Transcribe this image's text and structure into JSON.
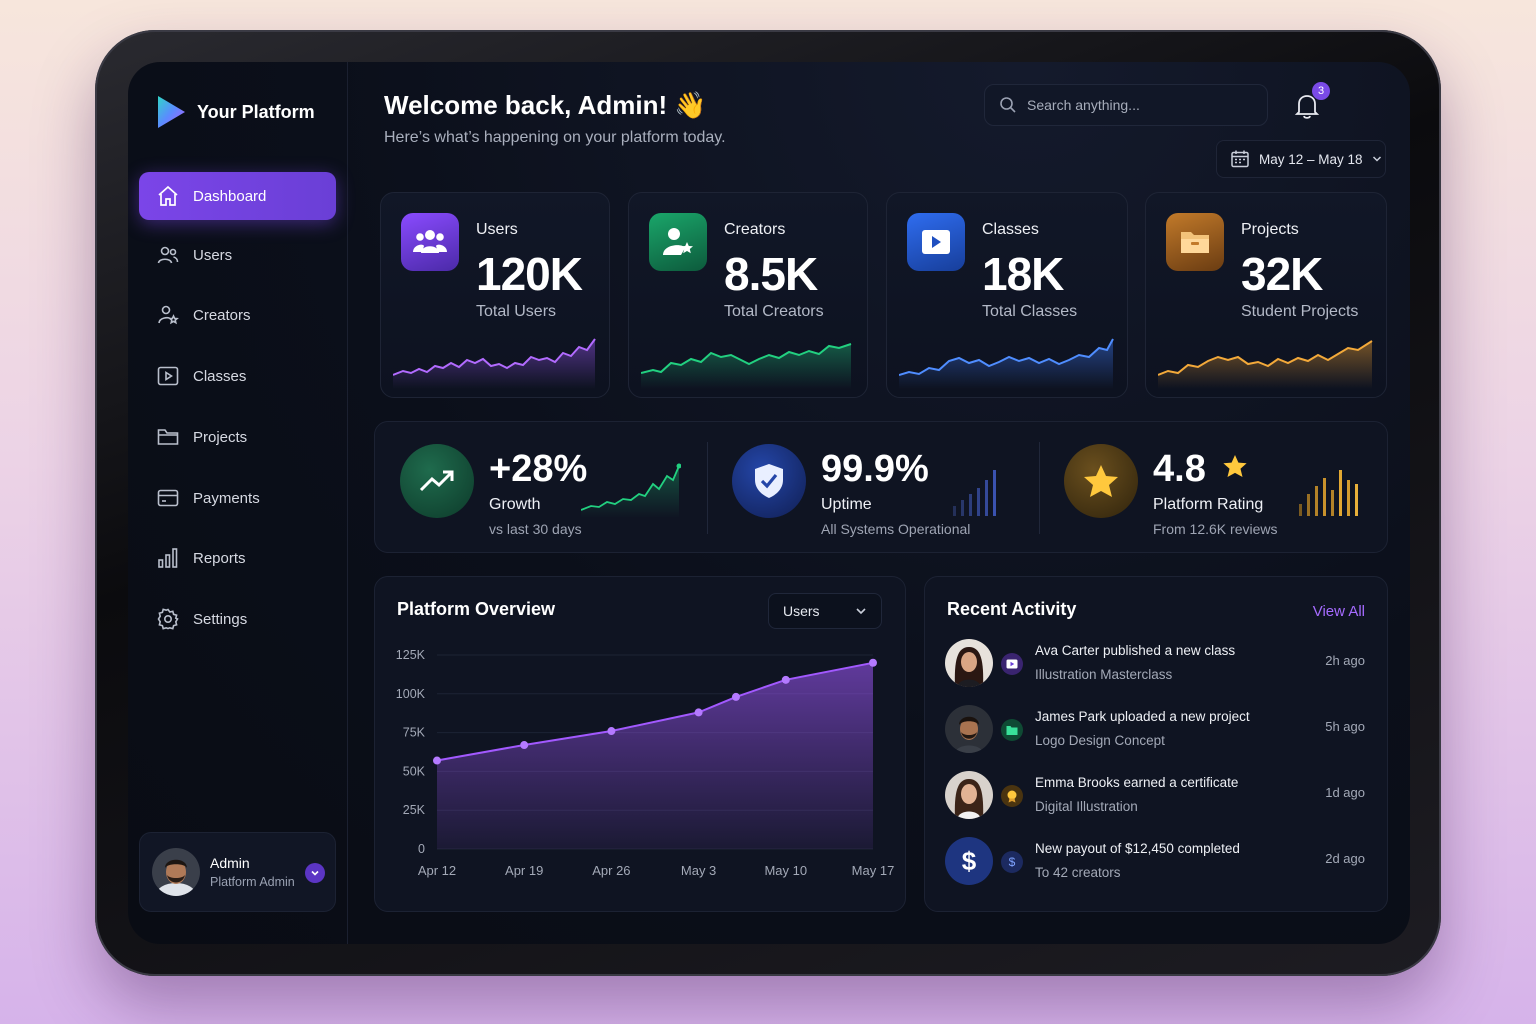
{
  "brand": {
    "name": "Your Platform"
  },
  "sidebar": {
    "items": [
      {
        "label": "Dashboard",
        "icon": "home-icon",
        "active": true
      },
      {
        "label": "Users",
        "icon": "users-icon"
      },
      {
        "label": "Creators",
        "icon": "creator-icon"
      },
      {
        "label": "Classes",
        "icon": "play-icon"
      },
      {
        "label": "Projects",
        "icon": "folder-icon"
      },
      {
        "label": "Payments",
        "icon": "card-icon"
      },
      {
        "label": "Reports",
        "icon": "bar-chart-icon"
      },
      {
        "label": "Settings",
        "icon": "gear-icon"
      }
    ],
    "profile": {
      "name": "Admin",
      "role": "Platform Admin"
    }
  },
  "header": {
    "welcome": "Welcome back, Admin! 👋",
    "subtitle": "Here’s what’s happening on your platform today.",
    "search_placeholder": "Search anything...",
    "notifications": "3",
    "date_range": "May 12 – May 18"
  },
  "stats": [
    {
      "label": "Users",
      "value": "120K",
      "sub": "Total Users",
      "color": "#a259ff",
      "icon": "users-group-icon"
    },
    {
      "label": "Creators",
      "value": "8.5K",
      "sub": "Total Creators",
      "color": "#1fc27a",
      "icon": "creator-star-icon"
    },
    {
      "label": "Classes",
      "value": "18K",
      "sub": "Total Classes",
      "color": "#3f7dff",
      "icon": "play-icon"
    },
    {
      "label": "Projects",
      "value": "32K",
      "sub": "Student Projects",
      "color": "#f0a030",
      "icon": "folder-icon"
    }
  ],
  "metrics": [
    {
      "value": "+28%",
      "label": "Growth",
      "sub": "vs last 30 days",
      "icon": "trend-up-icon"
    },
    {
      "value": "99.9%",
      "label": "Uptime",
      "sub": "All Systems Operational",
      "icon": "shield-check-icon"
    },
    {
      "value": "4.8",
      "label": "Platform Rating",
      "sub": "From 12.6K reviews",
      "icon": "star-icon"
    }
  ],
  "overview": {
    "title": "Platform Overview",
    "selected": "Users"
  },
  "chart_data": {
    "type": "area",
    "x": [
      "Apr 12",
      "Apr 19",
      "Apr 26",
      "May 3",
      "May 10",
      "May 17"
    ],
    "points": [
      {
        "x": "Apr 12",
        "y": 57000
      },
      {
        "x": "Apr 19",
        "y": 67000
      },
      {
        "x": "Apr 26",
        "y": 76000
      },
      {
        "x": "May 3",
        "y": 88000
      },
      {
        "x": "May 6",
        "y": 98000
      },
      {
        "x": "May 10",
        "y": 109000
      },
      {
        "x": "May 17",
        "y": 120000
      }
    ],
    "yticks": [
      "125K",
      "100K",
      "75K",
      "50K",
      "25K",
      "0"
    ],
    "ylim": [
      0,
      125000
    ],
    "color": "#a259ff"
  },
  "activity": {
    "title": "Recent Activity",
    "view_all": "View All",
    "items": [
      {
        "title": "Ava Carter published a new class",
        "sub": "Illustration Masterclass",
        "time": "2h ago",
        "badge": "play-icon"
      },
      {
        "title": "James Park uploaded a new project",
        "sub": "Logo Design Concept",
        "time": "5h ago",
        "badge": "folder-icon"
      },
      {
        "title": "Emma Brooks earned a certificate",
        "sub": "Digital Illustration",
        "time": "1d ago",
        "badge": "medal-icon"
      },
      {
        "title": "New payout of $12,450 completed",
        "sub": "To 42 creators",
        "time": "2d ago",
        "badge": "dollar-icon"
      }
    ]
  }
}
